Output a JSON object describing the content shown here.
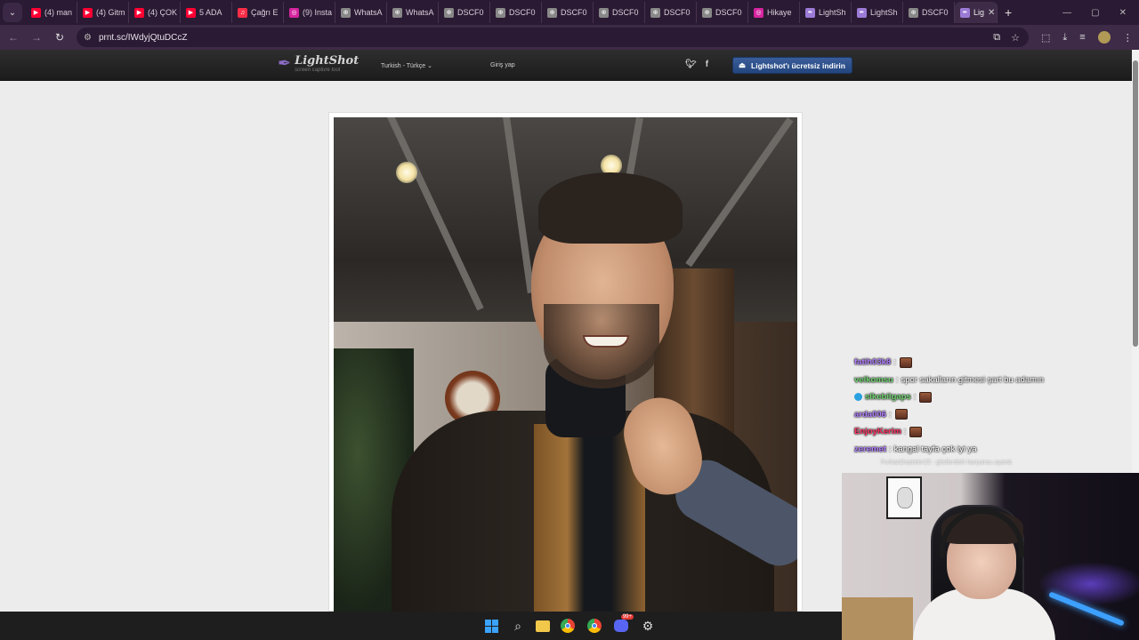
{
  "browser": {
    "tabs": [
      {
        "label": "(4) man",
        "icon": "youtube-icon",
        "color": "#ff0033"
      },
      {
        "label": "(4) Gitm",
        "icon": "youtube-icon",
        "color": "#ff0033"
      },
      {
        "label": "(4) ÇOK",
        "icon": "youtube-icon",
        "color": "#ff0033"
      },
      {
        "label": "5 ADA",
        "icon": "youtube-icon",
        "color": "#ff0033"
      },
      {
        "label": "Çağrı E",
        "icon": "music-icon",
        "color": "#fa2d48"
      },
      {
        "label": "(9) Insta",
        "icon": "instagram-icon",
        "color": "#d6249f"
      },
      {
        "label": "WhatsA",
        "icon": "globe-icon",
        "color": "#888888"
      },
      {
        "label": "WhatsA",
        "icon": "globe-icon",
        "color": "#888888"
      },
      {
        "label": "DSCF0",
        "icon": "globe-icon",
        "color": "#888888"
      },
      {
        "label": "DSCF0",
        "icon": "globe-icon",
        "color": "#888888"
      },
      {
        "label": "DSCF0",
        "icon": "globe-icon",
        "color": "#888888"
      },
      {
        "label": "DSCF0",
        "icon": "globe-icon",
        "color": "#888888"
      },
      {
        "label": "DSCF0",
        "icon": "globe-icon",
        "color": "#888888"
      },
      {
        "label": "DSCF0",
        "icon": "globe-icon",
        "color": "#888888"
      },
      {
        "label": "Hikaye",
        "icon": "instagram-icon",
        "color": "#d6249f"
      },
      {
        "label": "LightSh",
        "icon": "feather-icon",
        "color": "#9b7bd6"
      },
      {
        "label": "LightSh",
        "icon": "feather-icon",
        "color": "#9b7bd6"
      },
      {
        "label": "DSCF0",
        "icon": "globe-icon",
        "color": "#888888"
      }
    ],
    "active_tab": {
      "label": "Lig",
      "icon": "feather-icon"
    },
    "url": "prnt.sc/IWdyjQtuDCcZ"
  },
  "lightshot": {
    "logo_name": "LightShot",
    "logo_tagline": "screen capture tool",
    "language": "Turkish - Türkçe",
    "login": "Giriş yap",
    "download_button": "Lightshot'ı ücretsiz indirin"
  },
  "chat": [
    {
      "user": "fatih03k8",
      "message": "",
      "color": "#b07cff",
      "emote": true,
      "badge": false
    },
    {
      "user": "velkomsu",
      "message": "spor sakalların gitmesi şart bu adamın",
      "color": "#6fd36f",
      "emote": false,
      "badge": false
    },
    {
      "user": "slkebilgaps",
      "message": "",
      "color": "#6fd36f",
      "emote": true,
      "badge": true
    },
    {
      "user": "arda006",
      "message": "",
      "color": "#b07cff",
      "emote": true,
      "badge": false
    },
    {
      "user": "EnjoyKerim",
      "message": "",
      "color": "#ff3060",
      "emote": true,
      "badge": false
    },
    {
      "user": "zeremet",
      "message": "kangal tayfa çok iyi ya",
      "color": "#b07cff",
      "emote": false,
      "badge": false
    }
  ],
  "chat_faded": "FurkanDepteler25 : gitsilerdeki kanyarau ayanä",
  "taskbar": {
    "icons": [
      "windows-start-icon",
      "search-icon",
      "file-explorer-icon",
      "chrome-icon",
      "chrome-icon",
      "discord-icon",
      "settings-icon"
    ],
    "discord_badge": "99+"
  }
}
